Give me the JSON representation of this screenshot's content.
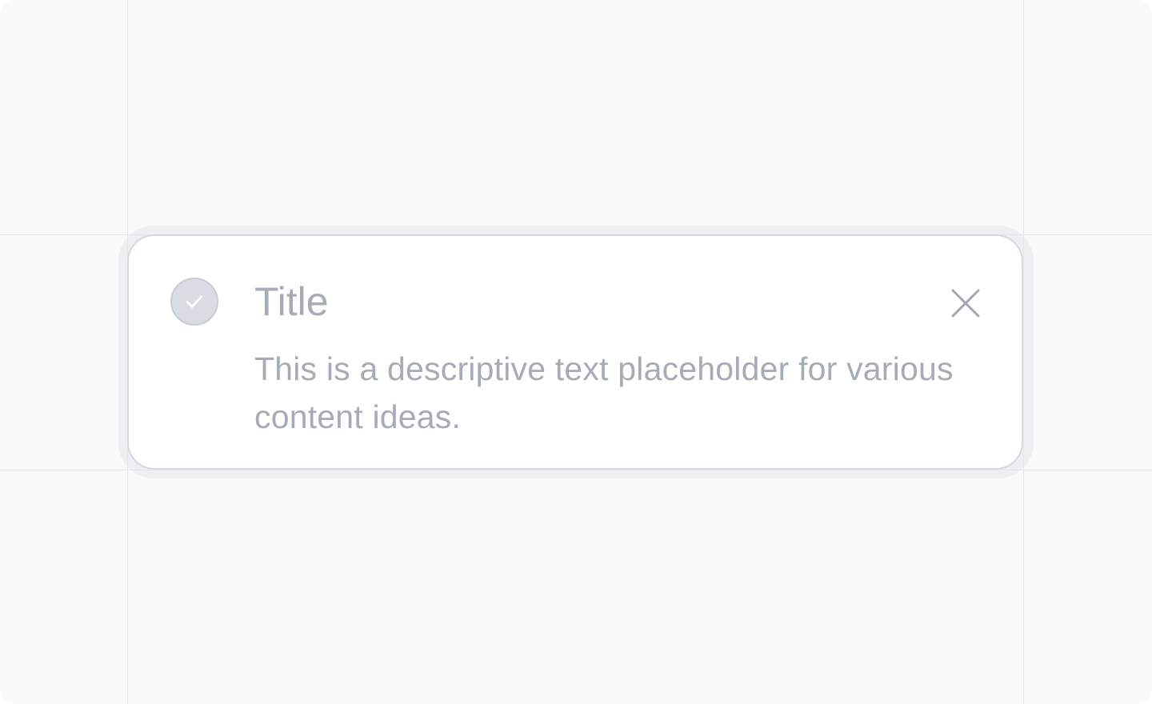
{
  "toast": {
    "title": "Title",
    "description": "This is a descriptive text placeholder for various content ideas.",
    "status_icon": "check-circle-icon",
    "close_icon": "close-icon"
  },
  "colors": {
    "background": "#fafafa",
    "guide_lines": "#e4e6ea",
    "card": "#ffffff",
    "card_border": "#d4d8df",
    "text": "#a6abb8",
    "icon_fill": "#d9dce2"
  }
}
